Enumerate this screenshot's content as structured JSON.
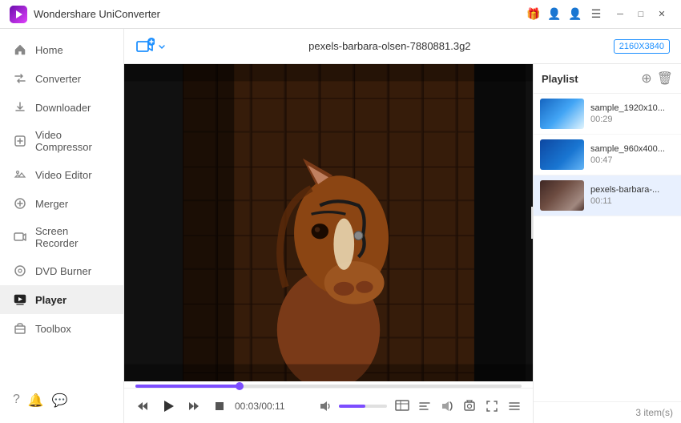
{
  "app": {
    "title": "Wondershare UniConverter",
    "logo_color": "#6a0dad"
  },
  "titlebar": {
    "title": "Wondershare UniConverter",
    "icons": [
      "gift-icon",
      "user-icon",
      "account-icon",
      "menu-icon"
    ],
    "controls": [
      "minimize",
      "maximize",
      "close"
    ]
  },
  "sidebar": {
    "items": [
      {
        "id": "home",
        "label": "Home",
        "icon": "🏠"
      },
      {
        "id": "converter",
        "label": "Converter",
        "icon": "⇄"
      },
      {
        "id": "downloader",
        "label": "Downloader",
        "icon": "⬇"
      },
      {
        "id": "video-compressor",
        "label": "Video Compressor",
        "icon": "📦"
      },
      {
        "id": "video-editor",
        "label": "Video Editor",
        "icon": "✂"
      },
      {
        "id": "merger",
        "label": "Merger",
        "icon": "⊕"
      },
      {
        "id": "screen-recorder",
        "label": "Screen Recorder",
        "icon": "⏺"
      },
      {
        "id": "dvd-burner",
        "label": "DVD Burner",
        "icon": "💿"
      },
      {
        "id": "player",
        "label": "Player",
        "icon": "▶",
        "active": true
      },
      {
        "id": "toolbox",
        "label": "Toolbox",
        "icon": "⚙"
      }
    ]
  },
  "topbar": {
    "add_btn_label": "+",
    "filename": "pexels-barbara-olsen-7880881.3g2",
    "resolution": "2160X3840"
  },
  "playlist": {
    "title": "Playlist",
    "items": [
      {
        "id": 1,
        "name": "sample_1920x10...",
        "duration": "00:29",
        "thumb": "ocean",
        "active": false
      },
      {
        "id": 2,
        "name": "sample_960x400...",
        "duration": "00:47",
        "thumb": "blue",
        "active": false
      },
      {
        "id": 3,
        "name": "pexels-barbara-...",
        "duration": "00:11",
        "thumb": "horse",
        "active": true
      }
    ],
    "count": "3 item(s)"
  },
  "controls": {
    "time_current": "00:03",
    "time_total": "00:11",
    "time_display": "00:03/00:11"
  },
  "footer": {
    "icons": [
      "help-icon",
      "bell-icon",
      "feedback-icon"
    ]
  }
}
